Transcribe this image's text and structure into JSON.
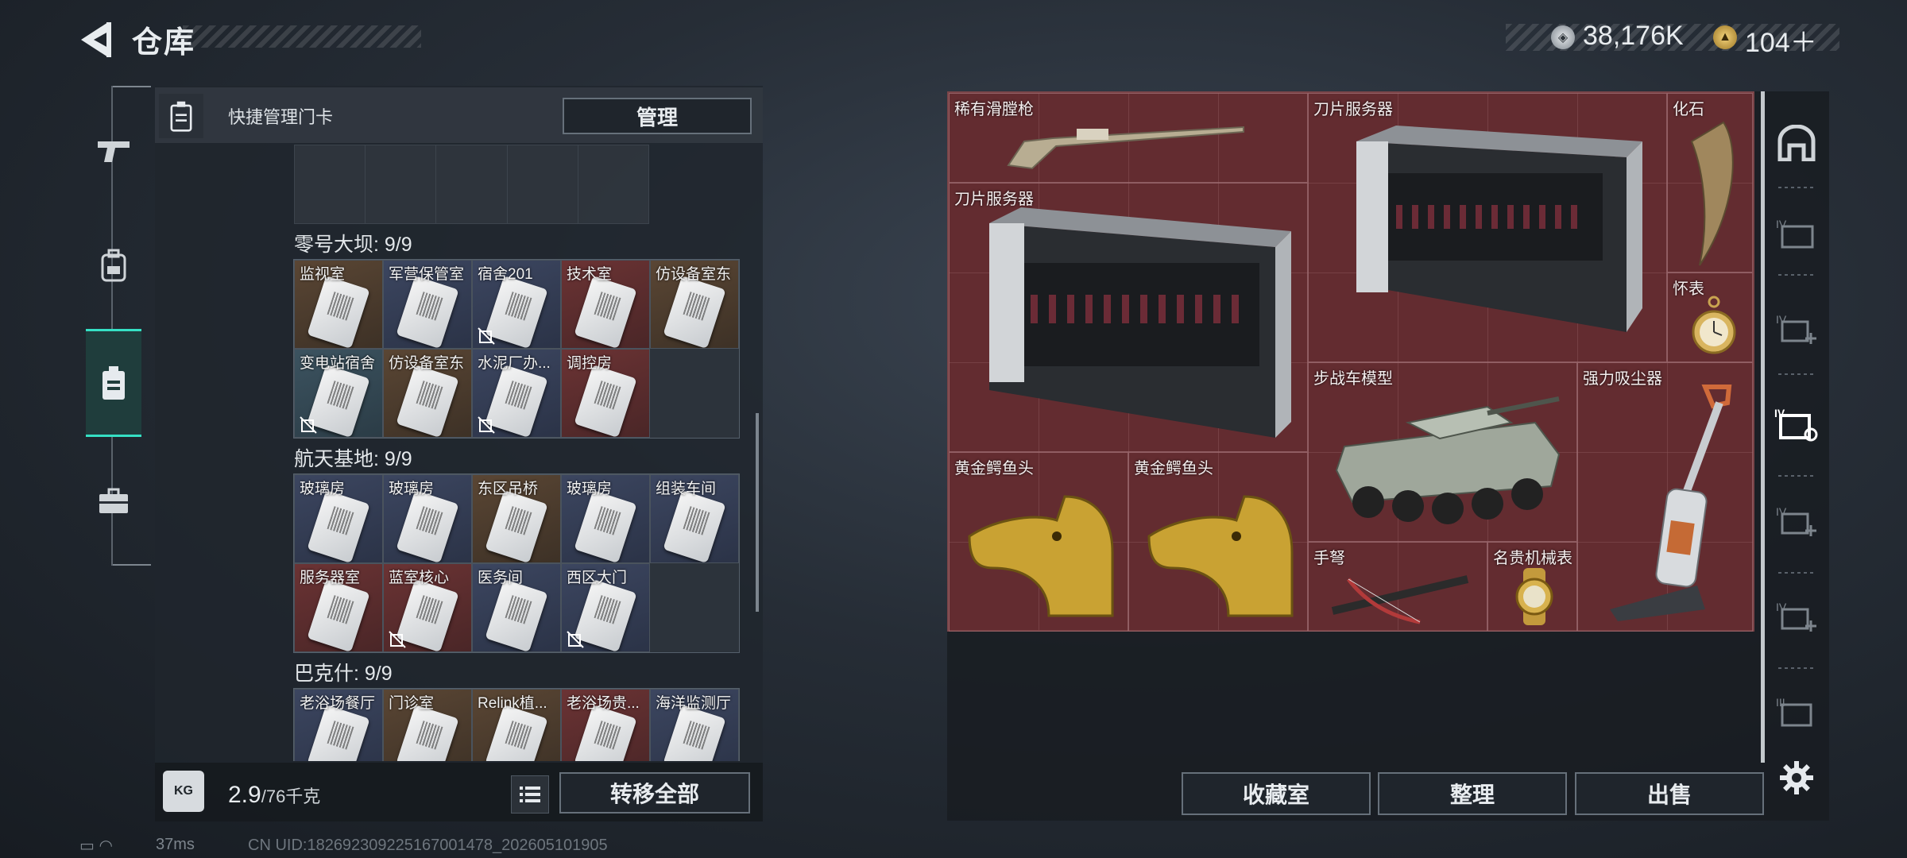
{
  "header": {
    "title": "仓库",
    "currency": [
      {
        "icon": "silver-coin-icon",
        "value": "38,176K"
      },
      {
        "icon": "gold-coin-icon",
        "value": "104＋"
      }
    ]
  },
  "nav": {
    "items": [
      {
        "name": "weapon",
        "icon": "pistol-icon"
      },
      {
        "name": "backpack",
        "icon": "backpack-icon"
      },
      {
        "name": "keycard",
        "icon": "keycard-icon",
        "active": true
      },
      {
        "name": "case",
        "icon": "briefcase-icon"
      }
    ]
  },
  "left": {
    "quick_label": "快捷管理门卡",
    "manage_label": "管理",
    "groups": [
      {
        "title": "零号大坝: 9/9",
        "cards": [
          {
            "label": "监视室",
            "color": "brown",
            "locked": false
          },
          {
            "label": "军营保管室",
            "color": "navy",
            "locked": false
          },
          {
            "label": "宿舍201",
            "color": "navy",
            "locked": true
          },
          {
            "label": "技术室",
            "color": "red",
            "locked": false
          },
          {
            "label": "仿设备室东",
            "color": "brown",
            "locked": false
          },
          {
            "label": "变电站宿舍",
            "color": "teal",
            "locked": true
          },
          {
            "label": "仿设备室东",
            "color": "brown",
            "locked": false
          },
          {
            "label": "水泥厂办...",
            "color": "navy",
            "locked": true
          },
          {
            "label": "调控房",
            "color": "red",
            "locked": false
          }
        ]
      },
      {
        "title": "航天基地: 9/9",
        "cards": [
          {
            "label": "玻璃房",
            "color": "navy",
            "locked": false
          },
          {
            "label": "玻璃房",
            "color": "navy",
            "locked": false
          },
          {
            "label": "东区吊桥",
            "color": "brown",
            "locked": false
          },
          {
            "label": "玻璃房",
            "color": "navy",
            "locked": false
          },
          {
            "label": "组装车间",
            "color": "navy",
            "locked": false
          },
          {
            "label": "服务器室",
            "color": "red",
            "locked": false
          },
          {
            "label": "蓝室核心",
            "color": "red",
            "locked": true
          },
          {
            "label": "医务间",
            "color": "navy",
            "locked": false
          },
          {
            "label": "西区大门",
            "color": "navy",
            "locked": true
          }
        ]
      },
      {
        "title": "巴克什: 9/9",
        "cards": [
          {
            "label": "老浴场餐厅",
            "color": "navy",
            "locked": false
          },
          {
            "label": "门诊室",
            "color": "brown",
            "locked": false
          },
          {
            "label": "Relink植...",
            "color": "brown",
            "locked": false
          },
          {
            "label": "老浴场贵...",
            "color": "red",
            "locked": false
          },
          {
            "label": "海洋监测厅",
            "color": "navy",
            "locked": false
          }
        ]
      }
    ],
    "weight_icon_label": "KG",
    "weight_value": "2.9",
    "weight_max": "/76千克",
    "transfer_label": "转移全部"
  },
  "stash": {
    "items": [
      {
        "label": "稀有滑膛枪",
        "icon": "musket-icon"
      },
      {
        "label": "刀片服务器",
        "icon": "blade-server-icon"
      },
      {
        "label": "化石",
        "icon": "fossil-claw-icon"
      },
      {
        "label": "刀片服务器",
        "icon": "blade-server-icon"
      },
      {
        "label": "怀表",
        "icon": "pocket-watch-icon"
      },
      {
        "label": "步战车模型",
        "icon": "ifv-model-icon"
      },
      {
        "label": "强力吸尘器",
        "icon": "vacuum-cleaner-icon"
      },
      {
        "label": "黄金鳄鱼头",
        "icon": "gold-crocodile-head-icon"
      },
      {
        "label": "黄金鳄鱼头",
        "icon": "gold-crocodile-head-icon"
      },
      {
        "label": "手弩",
        "icon": "crossbow-icon"
      },
      {
        "label": "名贵机械表",
        "icon": "luxury-watch-icon"
      }
    ],
    "buttons": {
      "collection": "收藏室",
      "sort": "整理",
      "sell": "出售"
    }
  },
  "status": {
    "ping": "37ms",
    "uid": "CN UID:1826923092251670014​78_202605101905"
  }
}
